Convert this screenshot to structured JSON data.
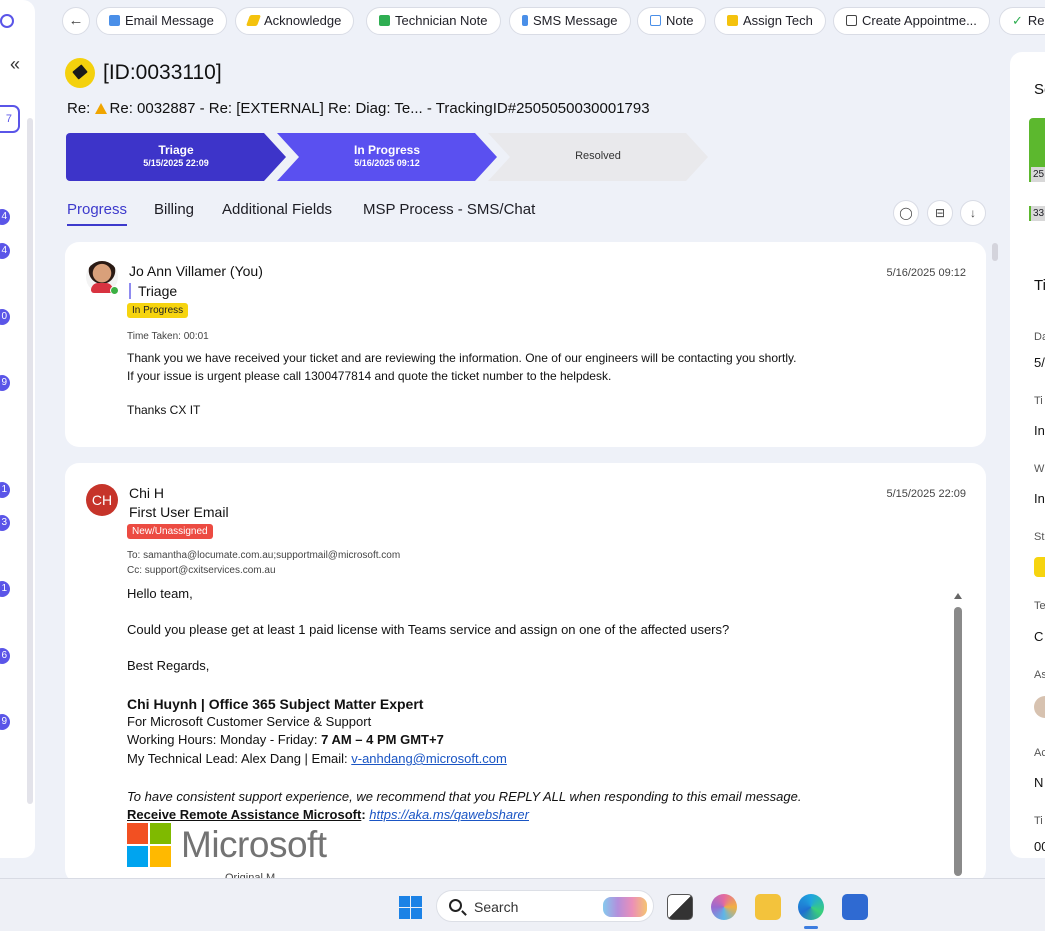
{
  "sidebar": {
    "tab_count": "7",
    "badges": [
      "4",
      "4",
      "0",
      "9",
      "1",
      "3",
      "1",
      "6",
      "9"
    ]
  },
  "toolbar": {
    "buttons": [
      {
        "label": "Email Message",
        "icon": "envelope-icon",
        "color": "#4a8fe8"
      },
      {
        "label": "Acknowledge",
        "icon": "lightning-icon",
        "color": "#f4c20d"
      },
      {
        "label": "Technician Note",
        "icon": "note-icon",
        "color": "#2fae52"
      },
      {
        "label": "SMS Message",
        "icon": "phone-icon",
        "color": "#4a8fe8"
      },
      {
        "label": "Note",
        "icon": "edit-icon",
        "color": "#4a8fe8"
      },
      {
        "label": "Assign Tech",
        "icon": "assign-icon",
        "color": "#f4c20d"
      },
      {
        "label": "Create Appointme...",
        "icon": "calendar-icon",
        "color": "#444444"
      },
      {
        "label": "Re",
        "icon": "check-icon",
        "color": "#2fae52"
      }
    ]
  },
  "ticket": {
    "id": "[ID:0033110]",
    "subject_prefix": "Re:",
    "subject_rest": "Re: 0032887 - Re: [EXTERNAL] Re: Diag: Te... - TrackingID#2505050030001793"
  },
  "stages": [
    {
      "name": "Triage",
      "date": "5/15/2025 22:09"
    },
    {
      "name": "In Progress",
      "date": "5/16/2025 09:12"
    },
    {
      "name": "Resolved",
      "date": ""
    }
  ],
  "tabs": [
    "Progress",
    "Billing",
    "Additional Fields",
    "MSP Process - SMS/Chat"
  ],
  "entries": [
    {
      "author": "Jo Ann Villamer (You)",
      "stage": "Triage",
      "status": "In Progress",
      "timestamp": "5/16/2025 09:12",
      "time_taken": "Time Taken: 00:01",
      "lines": [
        "Thank you we have received your ticket and are reviewing the information. One of our engineers will be contacting you shortly.",
        "If your issue is urgent please call 1300477814 and quote the ticket number to the helpdesk.",
        "Thanks CX IT"
      ]
    },
    {
      "initials": "CH",
      "author": "Chi H",
      "stage": "First User Email",
      "status": "New/Unassigned",
      "timestamp": "5/15/2025 22:09",
      "to": "To: samantha@locumate.com.au;supportmail@microsoft.com",
      "cc": "Cc: support@cxitservices.com.au",
      "greeting": "Hello team,",
      "request": "Could you please get at least 1 paid license with Teams service and assign on one of the affected users?",
      "regards": "Best Regards,",
      "sig_name": "Chi Huynh | Office 365 Subject Matter Expert",
      "sig_team": "For Microsoft Customer Service & Support",
      "sig_hours_label": "Working Hours: Monday - Friday: ",
      "sig_hours_value": "7 AM – 4 PM GMT+7",
      "sig_lead_label": "My Technical Lead: Alex Dang | Email:  ",
      "sig_lead_email": "v-anhdang@microsoft.com",
      "reply_all_note": "To have consistent support experience, we recommend that you REPLY ALL when responding to this email message.",
      "remote_label": "Receive Remote Assistance Microsoft",
      "remote_link": "https://aka.ms/qawebsharer",
      "logo_text": "Microsoft",
      "cut_text": "Original M..."
    }
  ],
  "right_panel": {
    "head1": "Se",
    "chip1": "25",
    "chip2": "33",
    "head2": "Ti",
    "labels": [
      {
        "label": "Da",
        "value": "5/"
      },
      {
        "label": "Ti",
        "value": "In"
      },
      {
        "label": "W",
        "value": "In"
      },
      {
        "label": "St",
        "value": ""
      },
      {
        "label": "Te",
        "value": "C"
      },
      {
        "label": "As",
        "value": ""
      },
      {
        "label": "Ac",
        "value": "N"
      },
      {
        "label": "Ti",
        "value": "00"
      }
    ]
  },
  "taskbar": {
    "search_text": "Search"
  },
  "colors": {
    "accent": "#5a50f0",
    "stage_done": "#3d34c9",
    "status_yellow": "#f6d40f",
    "status_red": "#ec4b42"
  }
}
